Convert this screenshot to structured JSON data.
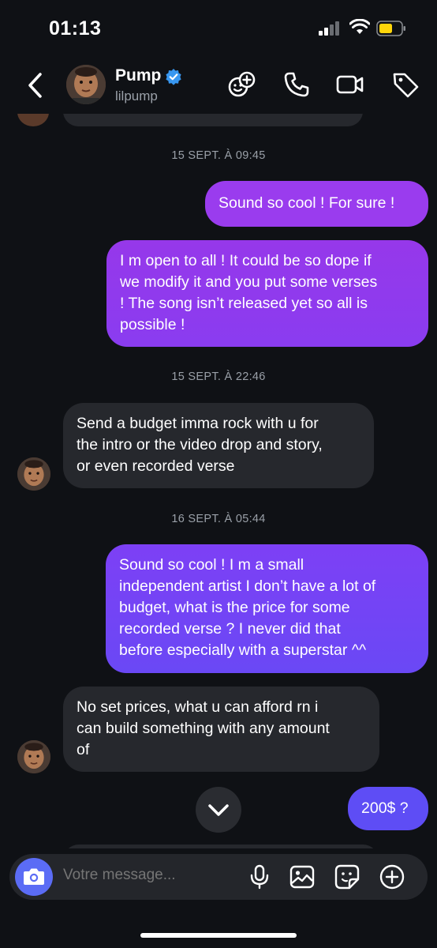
{
  "status_bar": {
    "time": "01:13"
  },
  "header": {
    "name": "Pump",
    "username": "lilpump"
  },
  "messages": [
    {
      "type": "timestamp",
      "text": "15 SEPT. À 09:45"
    },
    {
      "type": "outgoing",
      "lines": [
        "Sound so cool ! For sure !"
      ]
    },
    {
      "type": "outgoing",
      "lines": [
        "I m open to all ! It could be so dope if",
        "we modify it and you put some verses",
        "! The song isn’t released yet so all is",
        "possible !"
      ]
    },
    {
      "type": "timestamp",
      "text": "15 SEPT. À 22:46"
    },
    {
      "type": "incoming",
      "lines": [
        "Send a budget imma rock with u for",
        "the intro or the video drop and story,",
        "or even recorded verse"
      ]
    },
    {
      "type": "timestamp",
      "text": "16 SEPT. À 05:44"
    },
    {
      "type": "outgoing",
      "lines": [
        "Sound so cool !  I m a small",
        "independent artist I don’t have a lot of",
        "budget, what is the price for some",
        "recorded verse ? I never did that",
        "before especially with a superstar ^^"
      ]
    },
    {
      "type": "incoming",
      "lines": [
        "No set prices, what u can afford rn i",
        "can build something with any amount",
        "of"
      ]
    },
    {
      "type": "outgoing",
      "lines": [
        "200$ ?"
      ]
    }
  ],
  "composer": {
    "placeholder": "Votre message..."
  },
  "colors": {
    "accent": "#5b6cf5",
    "bubble_in": "#26282d",
    "background": "#0f1115",
    "verified": "#3897f0"
  },
  "icons": [
    "back-chevron-icon",
    "verified-badge-icon",
    "effects-icon",
    "phone-icon",
    "video-camera-icon",
    "tag-icon",
    "chevron-down-icon",
    "camera-icon",
    "microphone-icon",
    "image-icon",
    "sticker-icon",
    "plus-circle-icon"
  ]
}
